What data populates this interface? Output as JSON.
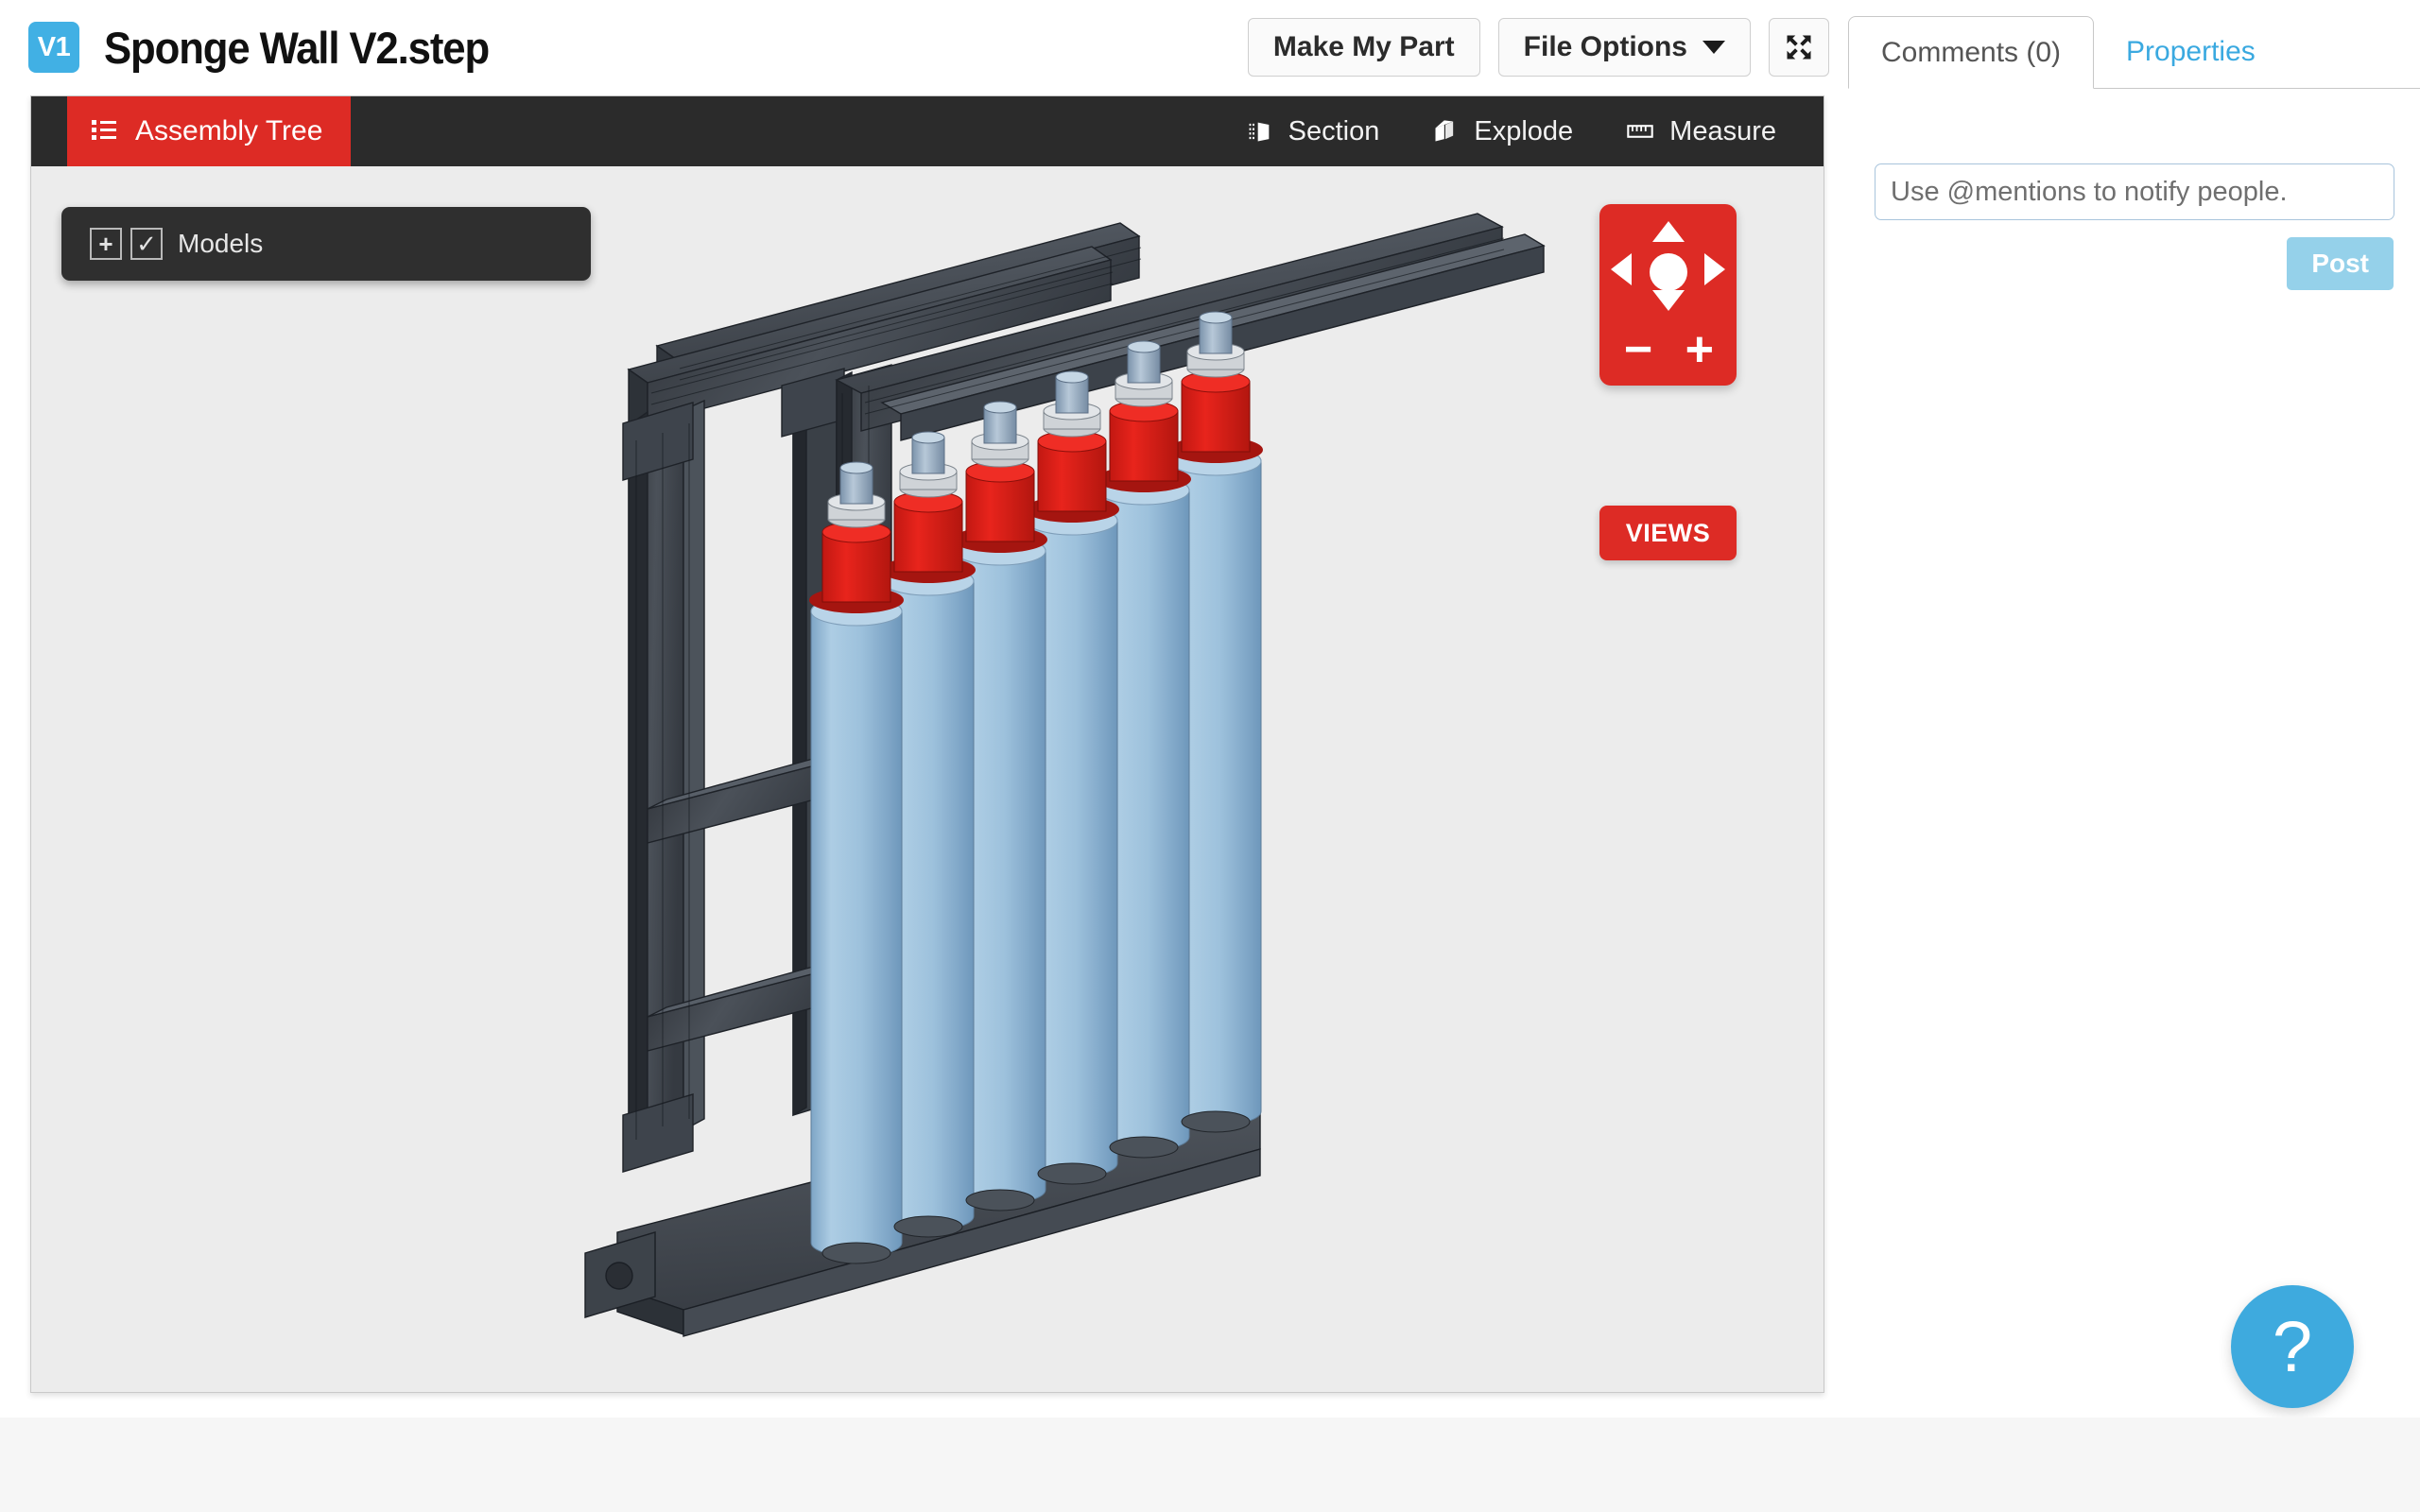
{
  "header": {
    "version_badge": "V1",
    "file_title": "Sponge Wall V2.step",
    "buttons": [
      {
        "label": "Make My Part",
        "icon": ""
      },
      {
        "label": "File Options",
        "icon": "chevron-down-icon"
      },
      {
        "label": "",
        "icon": "collapse-arrows-icon"
      }
    ],
    "make_my_part_label": "Make My Part",
    "file_options_label": "File Options",
    "collapse_tooltip": "Collapse"
  },
  "viewer": {
    "assembly_tree_label": "Assembly Tree",
    "tools": [
      {
        "label": "Section",
        "icon": "section-cube-icon"
      },
      {
        "label": "Explode",
        "icon": "explode-cube-icon"
      },
      {
        "label": "Measure",
        "icon": "ruler-icon"
      }
    ],
    "tree": {
      "expand_symbol": "+",
      "check_symbol": "✓",
      "root_label": "Models"
    },
    "nav": {
      "zoom_out": "−",
      "zoom_in": "+",
      "views_label": "VIEWS"
    },
    "background_color": "#ececec",
    "accent_red": "#dd2b25",
    "toolbar_color": "#2b2b2b"
  },
  "model": {
    "name": "Sponge Wall V2",
    "frame_color": "#4a4f55",
    "roller_color": "#9cc0dd",
    "bearing_block_color": "#dd1f19",
    "hardware_color": "#8fa8bf",
    "roller_count": 6
  },
  "right_panel": {
    "tabs": [
      {
        "label": "Comments (0)",
        "active": true
      },
      {
        "label": "Properties",
        "active": false
      }
    ],
    "comments_tab_label": "Comments (0)",
    "properties_tab_label": "Properties",
    "comment_placeholder": "Use @mentions to notify people.",
    "comment_value": "",
    "post_label": "Post",
    "help_symbol": "?",
    "accent_blue": "#3eaade"
  }
}
